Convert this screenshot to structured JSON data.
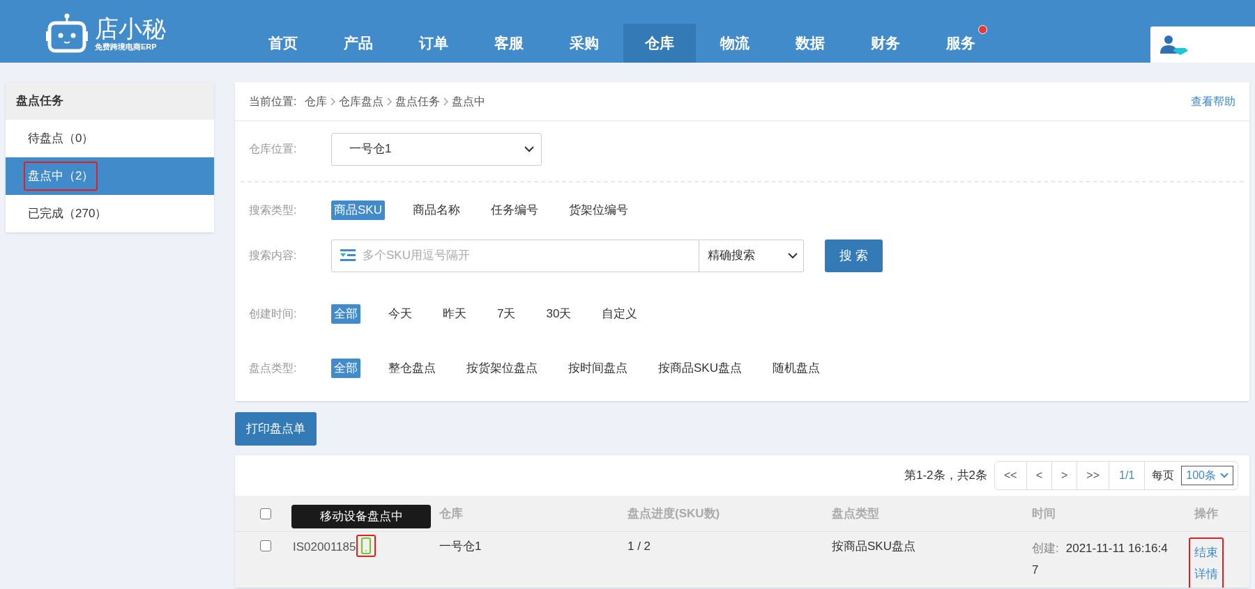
{
  "header": {
    "logo": {
      "name": "店小秘",
      "tagline": "免费跨境电商ERP"
    },
    "nav": [
      {
        "label": "首页",
        "selected": false,
        "badge": false
      },
      {
        "label": "产品",
        "selected": false,
        "badge": false
      },
      {
        "label": "订单",
        "selected": false,
        "badge": false
      },
      {
        "label": "客服",
        "selected": false,
        "badge": false
      },
      {
        "label": "采购",
        "selected": false,
        "badge": false
      },
      {
        "label": "仓库",
        "selected": true,
        "badge": false
      },
      {
        "label": "物流",
        "selected": false,
        "badge": false
      },
      {
        "label": "数据",
        "selected": false,
        "badge": false
      },
      {
        "label": "财务",
        "selected": false,
        "badge": false
      },
      {
        "label": "服务",
        "selected": false,
        "badge": true
      }
    ]
  },
  "sidebar": {
    "title": "盘点任务",
    "items": [
      {
        "label": "待盘点（0）",
        "selected": false,
        "highlighted": false
      },
      {
        "label": "盘点中（2）",
        "selected": true,
        "highlighted": true
      },
      {
        "label": "已完成（270）",
        "selected": false,
        "highlighted": false
      }
    ]
  },
  "breadcrumb": {
    "label": "当前位置:",
    "path": [
      "仓库",
      "仓库盘点",
      "盘点任务",
      "盘点中"
    ],
    "help": "查看帮助"
  },
  "filters": {
    "warehouse": {
      "label": "仓库位置:",
      "value": "一号仓1"
    },
    "search_type": {
      "label": "搜索类型:",
      "options": [
        {
          "label": "商品SKU",
          "selected": true
        },
        {
          "label": "商品名称",
          "selected": false
        },
        {
          "label": "任务编号",
          "selected": false
        },
        {
          "label": "货架位编号",
          "selected": false
        }
      ]
    },
    "search_content": {
      "label": "搜索内容:",
      "placeholder": "多个SKU用逗号隔开",
      "mode": "精确搜索",
      "button": "搜 索"
    },
    "created_time": {
      "label": "创建时间:",
      "options": [
        {
          "label": "全部",
          "selected": true
        },
        {
          "label": "今天",
          "selected": false
        },
        {
          "label": "昨天",
          "selected": false
        },
        {
          "label": "7天",
          "selected": false
        },
        {
          "label": "30天",
          "selected": false
        },
        {
          "label": "自定义",
          "selected": false
        }
      ]
    },
    "count_type": {
      "label": "盘点类型:",
      "options": [
        {
          "label": "全部",
          "selected": true
        },
        {
          "label": "整仓盘点",
          "selected": false
        },
        {
          "label": "按货架位盘点",
          "selected": false
        },
        {
          "label": "按时间盘点",
          "selected": false
        },
        {
          "label": "按商品SKU盘点",
          "selected": false
        },
        {
          "label": "随机盘点",
          "selected": false
        }
      ]
    }
  },
  "print_button": "打印盘点单",
  "pagination": {
    "summary": "第1-2条，共2条",
    "buttons": [
      "<<",
      "<",
      ">",
      ">>"
    ],
    "page": "1/1",
    "per_page_label": "每页",
    "per_page": "100条"
  },
  "table": {
    "columns": [
      "",
      "仓库",
      "盘点进度(SKU数)",
      "盘点类型",
      "时间",
      "操作"
    ],
    "tooltip": "移动设备盘点中",
    "select_all_checked": false,
    "rows": [
      {
        "checked": false,
        "task_no": "IS02001185",
        "mobile": true,
        "warehouse": "一号仓1",
        "progress": "1 / 2",
        "type": "按商品SKU盘点",
        "time_label": "创建:",
        "time": "2021-11-11 16:16:47",
        "actions": [
          "结束",
          "详情"
        ],
        "highlighted": true
      }
    ]
  }
}
